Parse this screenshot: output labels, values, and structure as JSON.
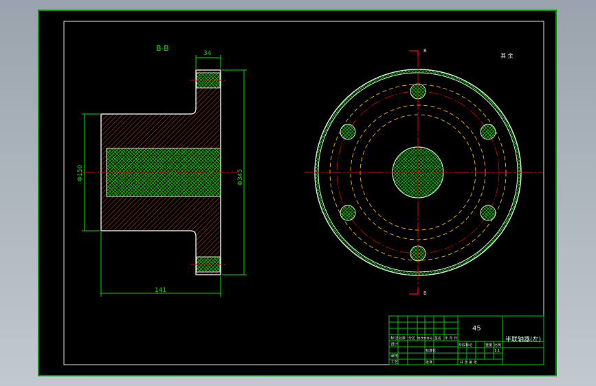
{
  "view": {
    "section_label": "B-B",
    "roughness_note": "其 余",
    "cut_marker": "B",
    "colors": {
      "frame": "#00c800",
      "part": "#d8d8d8",
      "hatch_red": "#a83a2a",
      "hatch_green": "#00c000",
      "centerline": "#e00000",
      "hidden": "#e8a800",
      "dim": "#00e000",
      "background": "#000000"
    }
  },
  "dimensions": {
    "flange_thickness": "34",
    "shaft_diameter": "Φ150",
    "flange_diameter": "Φ345",
    "overall_length": "141"
  },
  "title_block": {
    "material": "45",
    "part_name": "半联轴器(左)",
    "rows": {
      "r1": "标记",
      "r2": "设计",
      "r3": "审核",
      "r4": "工艺"
    },
    "cols": [
      "处数",
      "分区",
      "更改文件号",
      "签名",
      "年 月 日"
    ],
    "right_headers": [
      "阶段标记",
      "重量",
      "比例"
    ],
    "scale": "1:1",
    "sheet": "共 张 第 张",
    "std_labels": [
      "标准化",
      "批准"
    ]
  }
}
